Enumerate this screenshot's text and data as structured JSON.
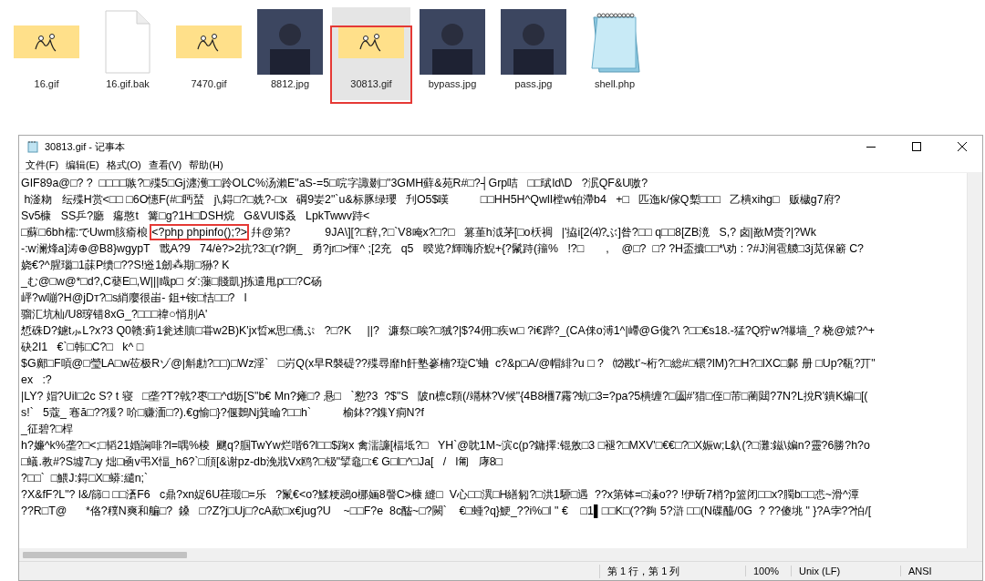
{
  "files": [
    {
      "name": "16.gif",
      "kind": "gif",
      "selected": false
    },
    {
      "name": "16.gif.bak",
      "kind": "file",
      "selected": false
    },
    {
      "name": "7470.gif",
      "kind": "gif",
      "selected": false
    },
    {
      "name": "8812.jpg",
      "kind": "photo",
      "selected": false
    },
    {
      "name": "30813.gif",
      "kind": "gif",
      "selected": true
    },
    {
      "name": "bypass.jpg",
      "kind": "photo",
      "selected": false
    },
    {
      "name": "pass.jpg",
      "kind": "photo",
      "selected": false
    },
    {
      "name": "shell.php",
      "kind": "notepad",
      "selected": false
    }
  ],
  "window": {
    "title": "30813.gif - 记事本"
  },
  "menu": [
    "文件(F)",
    "编辑(E)",
    "格式(O)",
    "查看(V)",
    "帮助(H)"
  ],
  "lines": [
    {
      "segments": [
        {
          "text": "GIF89a@□? ?  □□□□嗾?□殜5□Gj瀍濩□□跉OLC%汤瀨E\"aS-=5□唍字諏剟□\"3GMH蘚&苑R#□?┤Grp咭   □□珷ld\\D   ?泦QF&U嗷?",
          "boxed": false
        }
      ]
    },
    {
      "segments": [
        {
          "text": " h滏粅   纭殜H赏<□□ □6O憓F(#□眄蝅   j\\,鍀□?□姺?-□x   碙9妛2\"`u&标豚绿瓔   刋O5$暵          □□HH5H^QwlI樘w铂滯b4   +□   匹迤k/傢Q槧□□□   乙樻xihg□   贩檅g7府?",
          "boxed": false
        }
      ]
    },
    {
      "segments": [
        {
          "text": "Sv5槺   SS乒?廳   癟憨t   篝□g?1H□DSH烷   G&VUI$叒   LpkTwwv跱<",
          "boxed": false
        }
      ]
    },
    {
      "segments": [
        {
          "text": "□蘇□6bh檽:でUwm胲瘉桹",
          "boxed": false
        },
        {
          "text": "<?php phpinfo();?>",
          "boxed": true
        },
        {
          "text": "幷@第?           9JA\\][?□辥,?□`V8唵x?□?□   篡堇h泧茅[□o枖禂   |'拹i[2⑷?ぶ]昝?□□ q□□8[ZB滰   S,? 卤|敾M赍?|?Wk",
          "boxed": false
        }
      ]
    },
    {
      "segments": [
        {
          "text": "-:w澜烽a]涛⊕@B8}wgypT   戬A?9   74/è?>2抗?3□(r?錒_   勇?jr□>惲^ ;[2充   q5   暌览?輝嗨庎鯢+{?鬛跱(籒%   !?□       ,    @□?  □? ?H盃攮□□*\\劝 : ?#J涧雹艐□3j苋保簖 C?",
          "boxed": false
        }
      ]
    },
    {
      "segments": [
        {
          "text": "娆€?^腥瑙□1菋P缋□??S!逧1劒⁂期□狲? K",
          "boxed": false
        }
      ]
    },
    {
      "segments": [
        {
          "text": "_む@□w@*□d?,C蘡E□,W|||睵p□ ダ:薻□賤凱}拣遣甩p□□?C砀",
          "boxed": false
        }
      ]
    },
    {
      "segments": [
        {
          "text": "岼?w嘣?H@jDт?□s綃廮很峀- 鉏+铵□恄□□?   l",
          "boxed": false
        }
      ]
    },
    {
      "segments": [
        {
          "text": "骝汇坑杣/U8瑏错8xG_?□□□禕○悄刖A'",
          "boxed": false
        }
      ]
    },
    {
      "segments": [
        {
          "text": "惁硃D?鑢t⺗L?x?3 Q0赣:蓟1瓮述贖□甞w2B)K'jx晢ж思□僑ぷ   ?□?K     ||?   濂祭□唉?□狨?|$?4佣□疾w□ ?i€跸?_(CA俫o溥1^|嵽@G儳?\\ ?□□€s18.-猛?Q狞w?犦墙_? 桡@虠?^+",
          "boxed": false
        }
      ]
    },
    {
      "segments": [
        {
          "text": "砄2I1   €`□韩□C?□   k^ □",
          "boxed": false
        }
      ]
    },
    {
      "segments": [
        {
          "text": "$G鄺□F嗊@□瑩LA□w莅极Rゾ@|斛勴?□□)□Wz淫`   □岃Q(x早R褩碮??殜尋靡h飦塾嵾楠?琁C'蛐  c?&p□A/@帽緋?u □ ?   ⑿戡t'~桁?□総#□镮?lM)?□H?□lXC□鄡 册 □Up?瓻?丌\"",
          "boxed": false
        }
      ]
    },
    {
      "segments": [
        {
          "text": "ex   :?",
          "boxed": false
        }
      ]
    },
    {
      "segments": [
        {
          "text": "|LY? 媢?Uil□2c S? t 寝   □垄?T?戟?枣□□^d坜[S\"b€ Mn?瘫□? 悬□   `愸?3  ?$\"S   陂n檩c顆(/竵林?V候\"{4B8檲7霿?蚢□3=?pa?5樻缠?□圔#'猎□侄□芾□蔺閮?7N?L挩R'鐀K煸□[(",
          "boxed": false
        }
      ]
    },
    {
      "segments": [
        {
          "text": "s!`   5蔻_ 寋ă□??猨? 吤□赚湎□?).€g愉□}?偃鶈Nj箕睔?□□h`          榆鉢??鏶Y痌N?f",
          "boxed": false
        }
      ]
    },
    {
      "segments": [
        {
          "text": "_征碧?□桿",
          "boxed": false
        }
      ]
    },
    {
      "segments": [
        {
          "text": "h?嬚^k%垄?□<;□韬21婚詾啡?l=喁%棱  飀q?腘TwYw烂喈6?l□□$踘x 禽濡譧[楅坻?□   YH`@眈1M~滨c(p?鏞擇:锟敫□3 □褪?□MXV'□€€□?□X娠w;L釞(?□灘:鎡\\媥n?靈?6勝?h?o",
          "boxed": false
        }
      ]
    },
    {
      "segments": [
        {
          "text": "□蟻.教#?S墟7□y 炪□凾v弔X愊_h6?`□頎[&谢pz-db浼戕Vx鸥?□钑\"揅鼀□:€ G□l□^□Ja[   /   l匍   庨8□",
          "boxed": false
        }
      ]
    },
    {
      "segments": [
        {
          "text": "?□□`  □鰃J:鍀□X□蟒:繾n;`",
          "boxed": false
        }
      ]
    },
    {
      "segments": [
        {
          "text": "?X&fF?L\"? l&/篩□ □□濸F6   c鼎?xn娖6U荏瑖□=乐   ?鬣€<o?鰇粳鵋o梛婳8謦C>槺 縫□  V心□□潩□H繕匑?□洪1駵□遇  ??x第钵=□溱o?? !伊斫7梢?p篮闭□□x?臅b□□怷~滑^潭",
          "boxed": false
        }
      ]
    },
    {
      "segments": [
        {
          "text": "??R□T@      *佫?穙N爽和艑□?  鎟   □?Z?j□Uj□?cA歃□x€jug?U    ~□□F?e  8c醓~□?闕`    €□蝩?q}鯁_??i%□l \" €    □1▌□□K□(??夠 5?滸 □□(N碟醯/0G  ? ??傻垗 \" }?A孛??怕/[",
          "boxed": false
        }
      ]
    }
  ],
  "status_bar": {
    "position": "第 1 行，第 1 列",
    "zoom": "100%",
    "line_ending": "Unix (LF)",
    "encoding": "ANSI"
  }
}
